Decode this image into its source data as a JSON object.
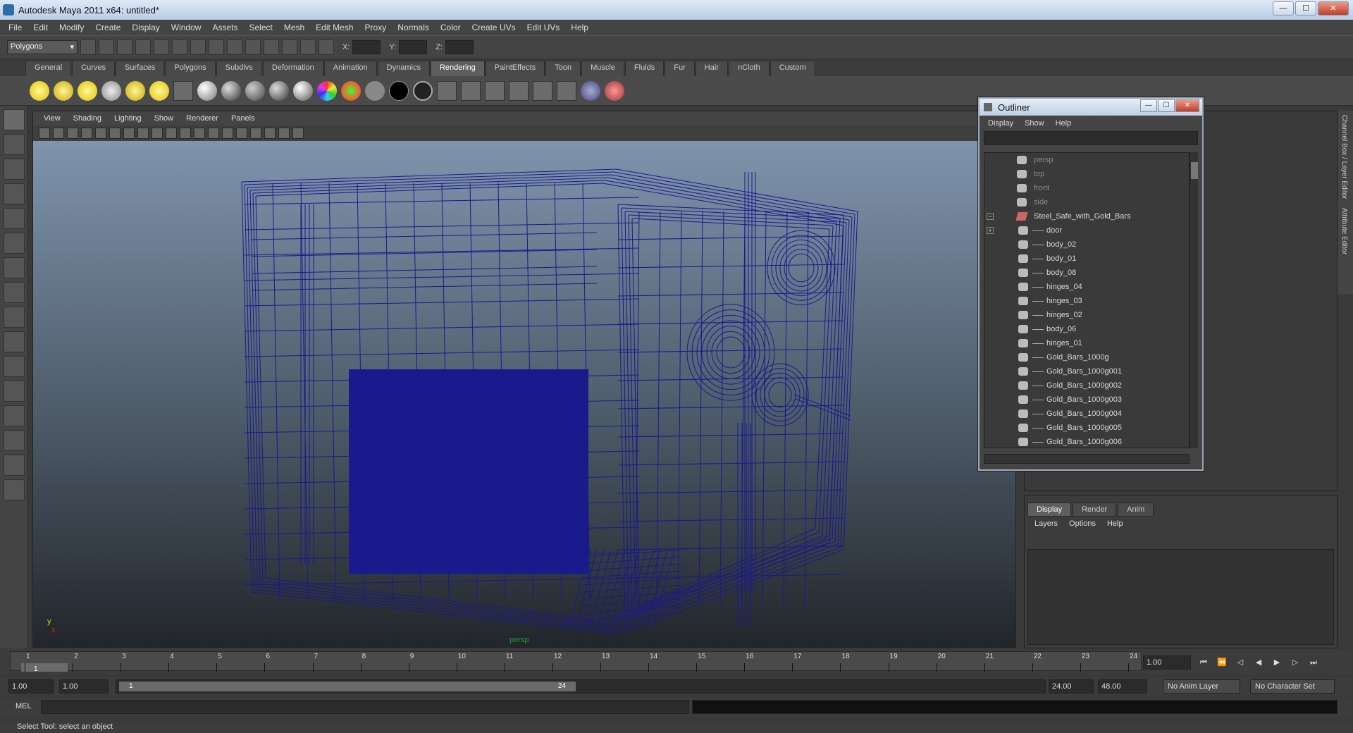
{
  "window": {
    "title": "Autodesk Maya 2011 x64: untitled*"
  },
  "menu": [
    "File",
    "Edit",
    "Modify",
    "Create",
    "Display",
    "Window",
    "Assets",
    "Select",
    "Mesh",
    "Edit Mesh",
    "Proxy",
    "Normals",
    "Color",
    "Create UVs",
    "Edit UVs",
    "Help"
  ],
  "status_line": {
    "mode": "Polygons",
    "x_label": "X:",
    "y_label": "Y:",
    "z_label": "Z:"
  },
  "shelf_tabs": [
    "General",
    "Curves",
    "Surfaces",
    "Polygons",
    "Subdivs",
    "Deformation",
    "Animation",
    "Dynamics",
    "Rendering",
    "PaintEffects",
    "Toon",
    "Muscle",
    "Fluids",
    "Fur",
    "Hair",
    "nCloth",
    "Custom"
  ],
  "shelf_active": "Rendering",
  "viewport": {
    "menu": [
      "View",
      "Shading",
      "Lighting",
      "Show",
      "Renderer",
      "Panels"
    ],
    "camera": "persp",
    "axis_y": "y",
    "axis_x": "x",
    "wire_color": "#1a1a8c"
  },
  "outliner": {
    "title": "Outliner",
    "menu": [
      "Display",
      "Show",
      "Help"
    ],
    "items": [
      {
        "label": "persp",
        "camera": true
      },
      {
        "label": "top",
        "camera": true
      },
      {
        "label": "front",
        "camera": true
      },
      {
        "label": "side",
        "camera": true
      },
      {
        "label": "Steel_Safe_with_Gold_Bars",
        "group": true,
        "expander": "−"
      },
      {
        "label": "door",
        "child": true,
        "expander": "+"
      },
      {
        "label": "body_02",
        "child": true
      },
      {
        "label": "body_01",
        "child": true
      },
      {
        "label": "body_08",
        "child": true
      },
      {
        "label": "hinges_04",
        "child": true
      },
      {
        "label": "hinges_03",
        "child": true
      },
      {
        "label": "hinges_02",
        "child": true
      },
      {
        "label": "body_06",
        "child": true
      },
      {
        "label": "hinges_01",
        "child": true
      },
      {
        "label": "Gold_Bars_1000g",
        "child": true
      },
      {
        "label": "Gold_Bars_1000g001",
        "child": true
      },
      {
        "label": "Gold_Bars_1000g002",
        "child": true
      },
      {
        "label": "Gold_Bars_1000g003",
        "child": true
      },
      {
        "label": "Gold_Bars_1000g004",
        "child": true
      },
      {
        "label": "Gold_Bars_1000g005",
        "child": true
      },
      {
        "label": "Gold_Bars_1000g006",
        "child": true
      }
    ]
  },
  "side_tabs": [
    "Channel Box / Layer Editor",
    "Attribute Editor"
  ],
  "layer_panel": {
    "tabs": [
      "Display",
      "Render",
      "Anim"
    ],
    "active": "Display",
    "menu": [
      "Layers",
      "Options",
      "Help"
    ]
  },
  "time_slider": {
    "ticks": [
      1,
      2,
      3,
      4,
      5,
      6,
      7,
      8,
      9,
      10,
      11,
      12,
      13,
      14,
      15,
      16,
      17,
      18,
      19,
      20,
      21,
      22,
      23,
      24
    ],
    "current_frame": "1",
    "current_field": "1.00"
  },
  "range_slider": {
    "start_time": "1.00",
    "playback_start": "1.00",
    "range_start": "1",
    "range_end": "24",
    "playback_end": "24.00",
    "end_time": "48.00",
    "anim_layer": "No Anim Layer",
    "char_set": "No Character Set"
  },
  "command_line": {
    "label": "MEL"
  },
  "help_line": "Select Tool: select an object"
}
